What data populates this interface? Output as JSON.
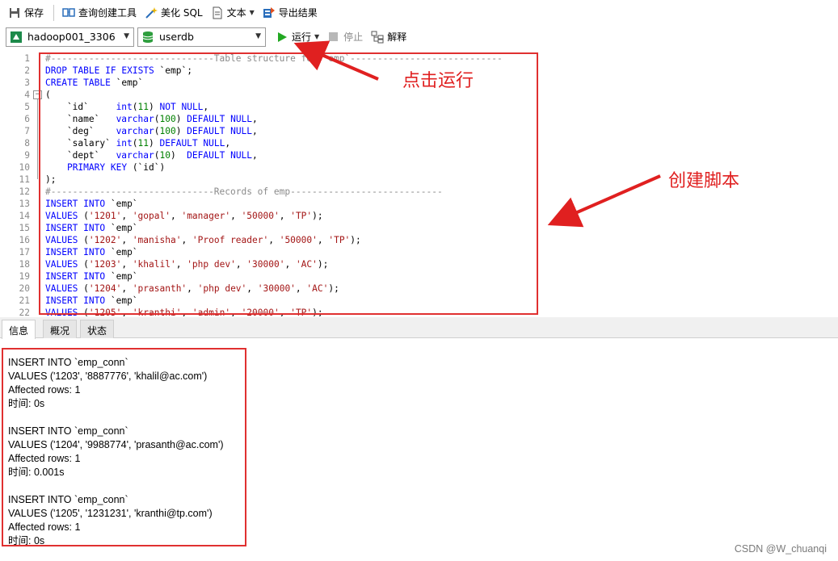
{
  "toolbar": {
    "save": "保存",
    "query_builder": "查询创建工具",
    "beautify_sql": "美化 SQL",
    "text": "文本",
    "export": "导出结果",
    "run": "运行",
    "stop": "停止",
    "explain": "解释"
  },
  "connection": {
    "selected": "hadoop001_3306"
  },
  "database": {
    "selected": "userdb"
  },
  "editor_lines": [
    "#------------------------------Table structure for `emp`----------------------------",
    "DROP TABLE IF EXISTS `emp`;",
    "CREATE TABLE `emp`",
    "(",
    "    `id`     int(11) NOT NULL,",
    "    `name`   varchar(100) DEFAULT NULL,",
    "    `deg`    varchar(100) DEFAULT NULL,",
    "    `salary` int(11) DEFAULT NULL,",
    "    `dept`   varchar(10)  DEFAULT NULL,",
    "    PRIMARY KEY (`id`)",
    ");",
    "#------------------------------Records of emp----------------------------",
    "INSERT INTO `emp`",
    "VALUES ('1201', 'gopal', 'manager', '50000', 'TP');",
    "INSERT INTO `emp`",
    "VALUES ('1202', 'manisha', 'Proof reader', '50000', 'TP');",
    "INSERT INTO `emp`",
    "VALUES ('1203', 'khalil', 'php dev', '30000', 'AC');",
    "INSERT INTO `emp`",
    "VALUES ('1204', 'prasanth', 'php dev', '30000', 'AC');",
    "INSERT INTO `emp`",
    "VALUES ('1205', 'kranthi', 'admin', '20000', 'TP');"
  ],
  "annotations": {
    "run": "点击运行",
    "script": "创建脚本"
  },
  "tabs": [
    "信息",
    "概况",
    "状态"
  ],
  "output_lines": [
    "INSERT INTO `emp_conn`",
    "VALUES ('1203', '8887776', 'khalil@ac.com')",
    "Affected rows: 1",
    "时间: 0s",
    "",
    "INSERT INTO `emp_conn`",
    "VALUES ('1204', '9988774', 'prasanth@ac.com')",
    "Affected rows: 1",
    "时间: 0.001s",
    "",
    "INSERT INTO `emp_conn`",
    "VALUES ('1205', '1231231', 'kranthi@tp.com')",
    "Affected rows: 1",
    "时间: 0s"
  ],
  "watermark": "CSDN @W_chuanqi",
  "colors": {
    "annotation_red": "#e03030",
    "keyword": "#0000ff",
    "number": "#008000",
    "string": "#a31515",
    "run_green": "#22a822"
  }
}
